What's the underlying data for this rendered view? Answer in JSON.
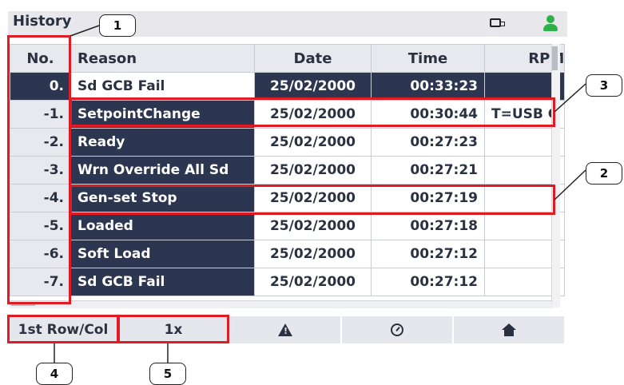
{
  "header": {
    "title": "History"
  },
  "table": {
    "columns": [
      "No.",
      "Reason",
      "Date",
      "Time",
      "RPM"
    ],
    "rows": [
      {
        "no": "0.",
        "reason": "Sd GCB Fail",
        "date": "25/02/2000",
        "time": "00:33:23",
        "rpm": ""
      },
      {
        "no": "-1.",
        "reason": "SetpointChange",
        "date": "25/02/2000",
        "time": "00:30:44",
        "rpm": "T=USB C"
      },
      {
        "no": "-2.",
        "reason": "Ready",
        "date": "25/02/2000",
        "time": "00:27:23",
        "rpm": ""
      },
      {
        "no": "-3.",
        "reason": "Wrn Override All Sd",
        "date": "25/02/2000",
        "time": "00:27:21",
        "rpm": ""
      },
      {
        "no": "-4.",
        "reason": "Gen-set Stop",
        "date": "25/02/2000",
        "time": "00:27:19",
        "rpm": ""
      },
      {
        "no": "-5.",
        "reason": "Loaded",
        "date": "25/02/2000",
        "time": "00:27:18",
        "rpm": ""
      },
      {
        "no": "-6.",
        "reason": "Soft Load",
        "date": "25/02/2000",
        "time": "00:27:12",
        "rpm": ""
      },
      {
        "no": "-7.",
        "reason": "Sd GCB Fail",
        "date": "25/02/2000",
        "time": "00:27:12",
        "rpm": ""
      }
    ]
  },
  "bottom_bar": {
    "first_row_col": "1st Row/Col",
    "zoom": "1x",
    "icons": [
      "warning-icon",
      "gauge-icon",
      "home-icon"
    ]
  },
  "status_icons": [
    "card-icon",
    "user-icon"
  ],
  "callouts": [
    "1",
    "2",
    "3",
    "4",
    "5"
  ],
  "colors": {
    "accent_dark": "#2d3650",
    "callout_red": "#e01b24",
    "user_green": "#2fb14a"
  }
}
